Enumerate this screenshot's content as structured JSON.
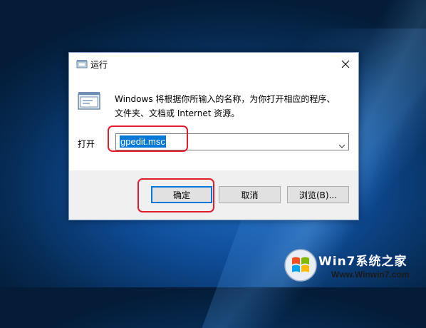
{
  "dialog": {
    "title": "运行",
    "description_line1": "Windows 将根据你所输入的名称，为你打开相应的程序、",
    "description_line2": "文件夹、文档或 Internet 资源。",
    "open_label": "打开",
    "input_value": "gpedit.msc",
    "ok_label": "确定",
    "cancel_label": "取消",
    "browse_label": "浏览(B)..."
  },
  "watermark": {
    "brand": "Win7系统之家",
    "url": "Www.Winwin7.com"
  },
  "colors": {
    "selection": "#0078d7",
    "highlight": "#e11d2b",
    "dialog_bg": "#f0f0f0"
  },
  "icons": [
    "run-icon",
    "run-large-icon",
    "close-icon",
    "chevron-down-icon",
    "windows-logo-icon"
  ]
}
